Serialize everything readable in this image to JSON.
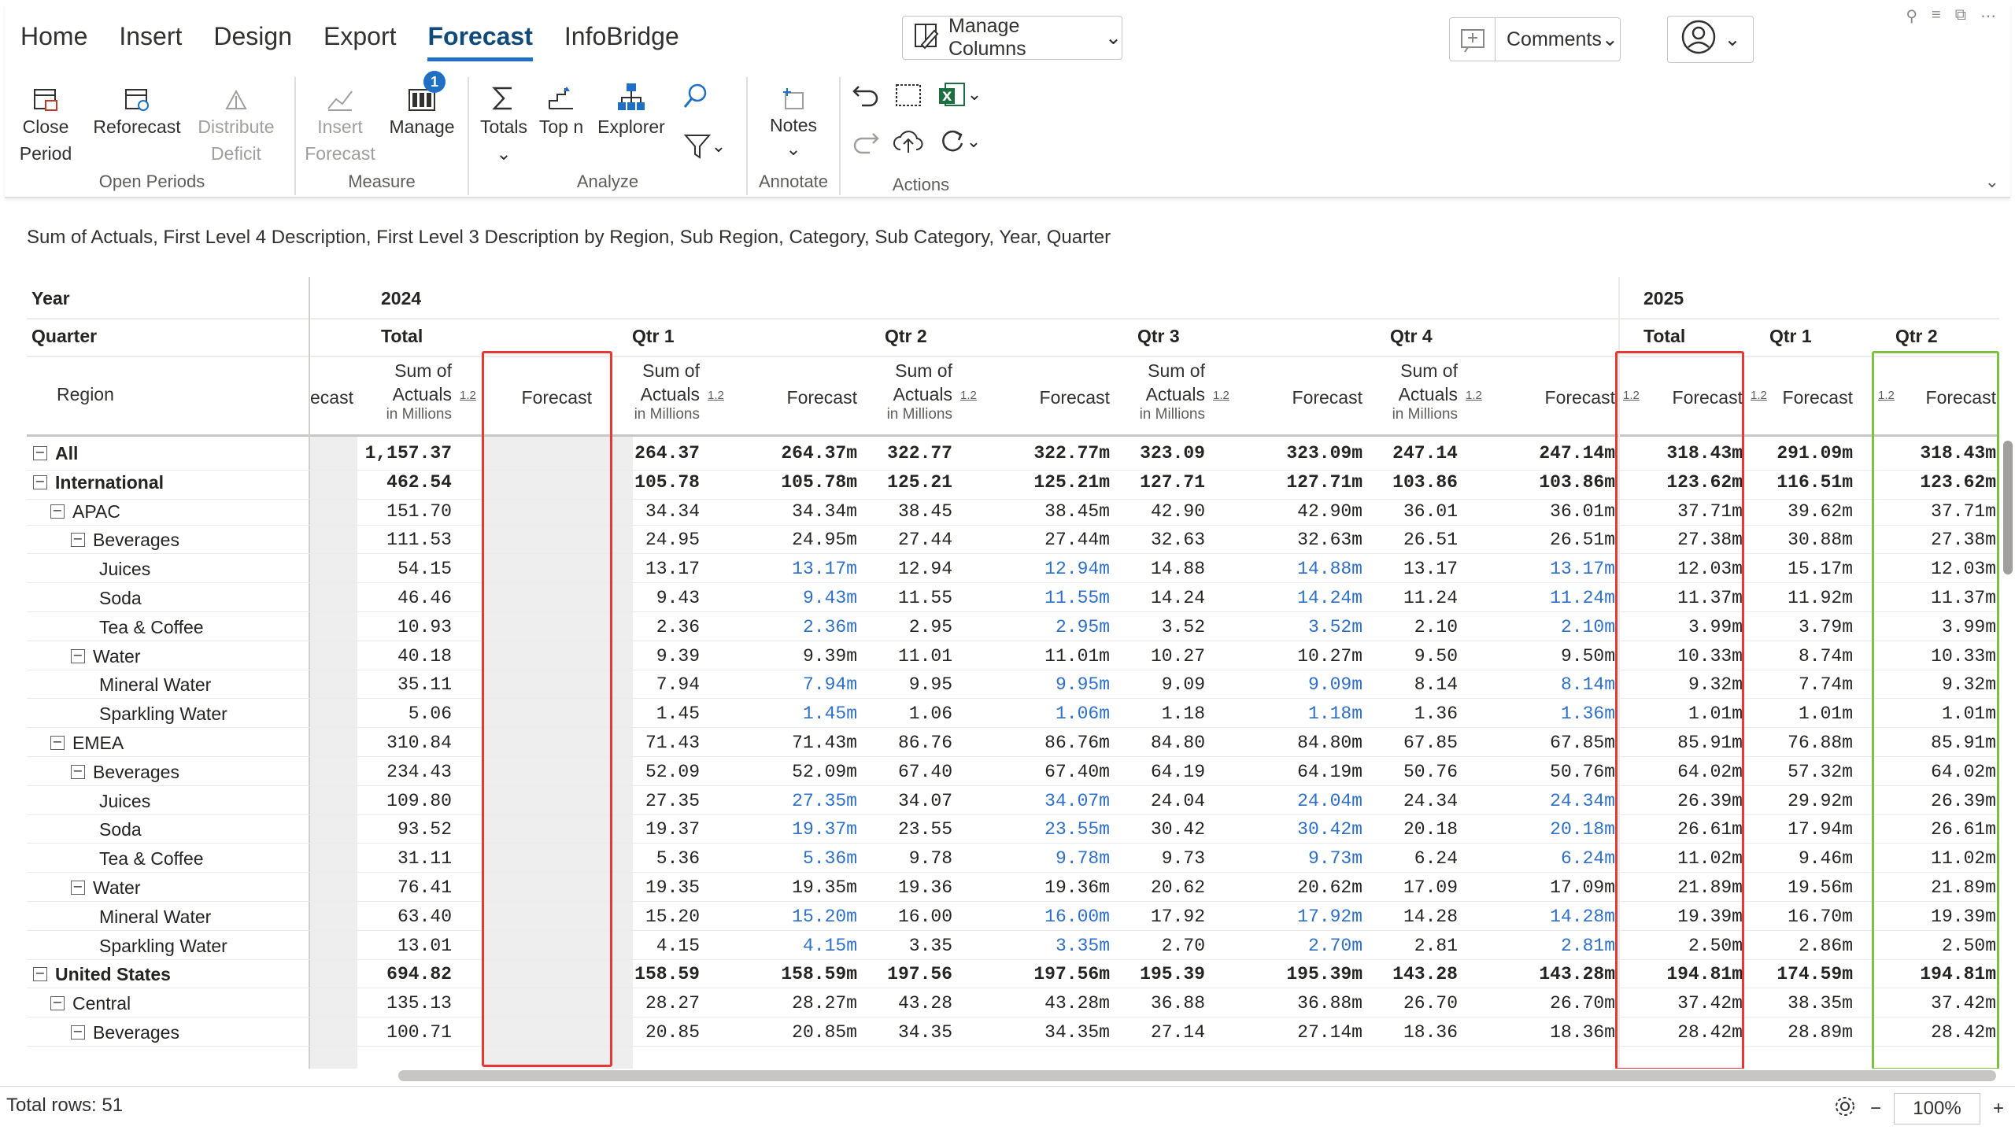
{
  "ribbon": {
    "tabs": [
      "Home",
      "Insert",
      "Design",
      "Export",
      "Forecast",
      "InfoBridge"
    ],
    "active_tab": "Forecast",
    "manage_columns": "Manage Columns",
    "comments": "Comments",
    "groups": {
      "open_periods": {
        "label": "Open Periods",
        "close": [
          "Close",
          "Period"
        ],
        "reforecast": "Reforecast",
        "distribute": [
          "Distribute",
          "Deficit"
        ]
      },
      "measure": {
        "label": "Measure",
        "insert": [
          "Insert",
          "Forecast"
        ],
        "manage": "Manage",
        "manage_badge": "1"
      },
      "analyze": {
        "label": "Analyze",
        "totals": "Totals",
        "topn": "Top n",
        "explorer": "Explorer"
      },
      "annotate": {
        "label": "Annotate",
        "notes": "Notes"
      },
      "actions": {
        "label": "Actions"
      }
    }
  },
  "description": "Sum of Actuals, First Level 4 Description, First Level 3 Description by Region, Sub Region, Category, Sub Category, Year, Quarter",
  "grid": {
    "row_header": {
      "year": "Year",
      "quarter": "Quarter",
      "region": "Region"
    },
    "partial_col": "ecast",
    "years": [
      "2024",
      "2025"
    ],
    "quarters": [
      "Total",
      "Qtr 1",
      "Qtr 2",
      "Qtr 3",
      "Qtr 4",
      "Total",
      "Qtr 1",
      "Qtr 2"
    ],
    "measure_sum": [
      "Sum of",
      "Actuals"
    ],
    "measure_unit": "in Millions",
    "measure_fc": "Forecast",
    "icon_12": "1.2",
    "rows": [
      {
        "label": "All",
        "level": 0,
        "bold": true,
        "tog": true,
        "vals": [
          "1,157.37",
          "",
          "264.37",
          "264.37m",
          "322.77",
          "322.77m",
          "323.09",
          "323.09m",
          "247.14",
          "247.14m",
          "318.43m",
          "291.09m",
          "318.43m"
        ]
      },
      {
        "label": "International",
        "level": 0,
        "bold": true,
        "tog": true,
        "vals": [
          "462.54",
          "",
          "105.78",
          "105.78m",
          "125.21",
          "125.21m",
          "127.71",
          "127.71m",
          "103.86",
          "103.86m",
          "123.62m",
          "116.51m",
          "123.62m"
        ]
      },
      {
        "label": "APAC",
        "level": 1,
        "bold": false,
        "tog": true,
        "vals": [
          "151.70",
          "",
          "34.34",
          "34.34m",
          "38.45",
          "38.45m",
          "42.90",
          "42.90m",
          "36.01",
          "36.01m",
          "37.71m",
          "39.62m",
          "37.71m"
        ]
      },
      {
        "label": "Beverages",
        "level": 2,
        "bold": false,
        "tog": true,
        "vals": [
          "111.53",
          "",
          "24.95",
          "24.95m",
          "27.44",
          "27.44m",
          "32.63",
          "32.63m",
          "26.51",
          "26.51m",
          "27.38m",
          "30.88m",
          "27.38m"
        ]
      },
      {
        "label": "Juices",
        "level": 3,
        "bold": false,
        "tog": false,
        "leaf": true,
        "vals": [
          "54.15",
          "",
          "13.17",
          "13.17m",
          "12.94",
          "12.94m",
          "14.88",
          "14.88m",
          "13.17",
          "13.17m",
          "12.03m",
          "15.17m",
          "12.03m"
        ]
      },
      {
        "label": "Soda",
        "level": 3,
        "bold": false,
        "tog": false,
        "leaf": true,
        "vals": [
          "46.46",
          "",
          "9.43",
          "9.43m",
          "11.55",
          "11.55m",
          "14.24",
          "14.24m",
          "11.24",
          "11.24m",
          "11.37m",
          "11.92m",
          "11.37m"
        ]
      },
      {
        "label": "Tea & Coffee",
        "level": 3,
        "bold": false,
        "tog": false,
        "leaf": true,
        "vals": [
          "10.93",
          "",
          "2.36",
          "2.36m",
          "2.95",
          "2.95m",
          "3.52",
          "3.52m",
          "2.10",
          "2.10m",
          "3.99m",
          "3.79m",
          "3.99m"
        ]
      },
      {
        "label": "Water",
        "level": 2,
        "bold": false,
        "tog": true,
        "vals": [
          "40.18",
          "",
          "9.39",
          "9.39m",
          "11.01",
          "11.01m",
          "10.27",
          "10.27m",
          "9.50",
          "9.50m",
          "10.33m",
          "8.74m",
          "10.33m"
        ]
      },
      {
        "label": "Mineral Water",
        "level": 3,
        "bold": false,
        "tog": false,
        "leaf": true,
        "vals": [
          "35.11",
          "",
          "7.94",
          "7.94m",
          "9.95",
          "9.95m",
          "9.09",
          "9.09m",
          "8.14",
          "8.14m",
          "9.32m",
          "7.74m",
          "9.32m"
        ]
      },
      {
        "label": "Sparkling Water",
        "level": 3,
        "bold": false,
        "tog": false,
        "leaf": true,
        "vals": [
          "5.06",
          "",
          "1.45",
          "1.45m",
          "1.06",
          "1.06m",
          "1.18",
          "1.18m",
          "1.36",
          "1.36m",
          "1.01m",
          "1.01m",
          "1.01m"
        ]
      },
      {
        "label": "EMEA",
        "level": 1,
        "bold": false,
        "tog": true,
        "vals": [
          "310.84",
          "",
          "71.43",
          "71.43m",
          "86.76",
          "86.76m",
          "84.80",
          "84.80m",
          "67.85",
          "67.85m",
          "85.91m",
          "76.88m",
          "85.91m"
        ]
      },
      {
        "label": "Beverages",
        "level": 2,
        "bold": false,
        "tog": true,
        "vals": [
          "234.43",
          "",
          "52.09",
          "52.09m",
          "67.40",
          "67.40m",
          "64.19",
          "64.19m",
          "50.76",
          "50.76m",
          "64.02m",
          "57.32m",
          "64.02m"
        ]
      },
      {
        "label": "Juices",
        "level": 3,
        "bold": false,
        "tog": false,
        "leaf": true,
        "vals": [
          "109.80",
          "",
          "27.35",
          "27.35m",
          "34.07",
          "34.07m",
          "24.04",
          "24.04m",
          "24.34",
          "24.34m",
          "26.39m",
          "29.92m",
          "26.39m"
        ]
      },
      {
        "label": "Soda",
        "level": 3,
        "bold": false,
        "tog": false,
        "leaf": true,
        "vals": [
          "93.52",
          "",
          "19.37",
          "19.37m",
          "23.55",
          "23.55m",
          "30.42",
          "30.42m",
          "20.18",
          "20.18m",
          "26.61m",
          "17.94m",
          "26.61m"
        ]
      },
      {
        "label": "Tea & Coffee",
        "level": 3,
        "bold": false,
        "tog": false,
        "leaf": true,
        "vals": [
          "31.11",
          "",
          "5.36",
          "5.36m",
          "9.78",
          "9.78m",
          "9.73",
          "9.73m",
          "6.24",
          "6.24m",
          "11.02m",
          "9.46m",
          "11.02m"
        ]
      },
      {
        "label": "Water",
        "level": 2,
        "bold": false,
        "tog": true,
        "vals": [
          "76.41",
          "",
          "19.35",
          "19.35m",
          "19.36",
          "19.36m",
          "20.62",
          "20.62m",
          "17.09",
          "17.09m",
          "21.89m",
          "19.56m",
          "21.89m"
        ]
      },
      {
        "label": "Mineral Water",
        "level": 3,
        "bold": false,
        "tog": false,
        "leaf": true,
        "vals": [
          "63.40",
          "",
          "15.20",
          "15.20m",
          "16.00",
          "16.00m",
          "17.92",
          "17.92m",
          "14.28",
          "14.28m",
          "19.39m",
          "16.70m",
          "19.39m"
        ]
      },
      {
        "label": "Sparkling Water",
        "level": 3,
        "bold": false,
        "tog": false,
        "leaf": true,
        "vals": [
          "13.01",
          "",
          "4.15",
          "4.15m",
          "3.35",
          "3.35m",
          "2.70",
          "2.70m",
          "2.81",
          "2.81m",
          "2.50m",
          "2.86m",
          "2.50m"
        ]
      },
      {
        "label": "United States",
        "level": 0,
        "bold": true,
        "tog": true,
        "vals": [
          "694.82",
          "",
          "158.59",
          "158.59m",
          "197.56",
          "197.56m",
          "195.39",
          "195.39m",
          "143.28",
          "143.28m",
          "194.81m",
          "174.59m",
          "194.81m"
        ]
      },
      {
        "label": "Central",
        "level": 1,
        "bold": false,
        "tog": true,
        "vals": [
          "135.13",
          "",
          "28.27",
          "28.27m",
          "43.28",
          "43.28m",
          "36.88",
          "36.88m",
          "26.70",
          "26.70m",
          "37.42m",
          "38.35m",
          "37.42m"
        ]
      },
      {
        "label": "Beverages",
        "level": 2,
        "bold": false,
        "tog": true,
        "vals": [
          "100.71",
          "",
          "20.85",
          "20.85m",
          "34.35",
          "34.35m",
          "27.14",
          "27.14m",
          "18.36",
          "18.36m",
          "28.42m",
          "28.89m",
          "28.42m"
        ]
      }
    ]
  },
  "colors": {
    "accent": "#1f6fc4",
    "forecast_blue": "#2e6fc7",
    "red_highlight": "#e53935",
    "green_highlight": "#7cc142",
    "shade": "#eeeeee"
  },
  "status": {
    "total_rows": "Total rows: 51",
    "zoom": "100%"
  }
}
